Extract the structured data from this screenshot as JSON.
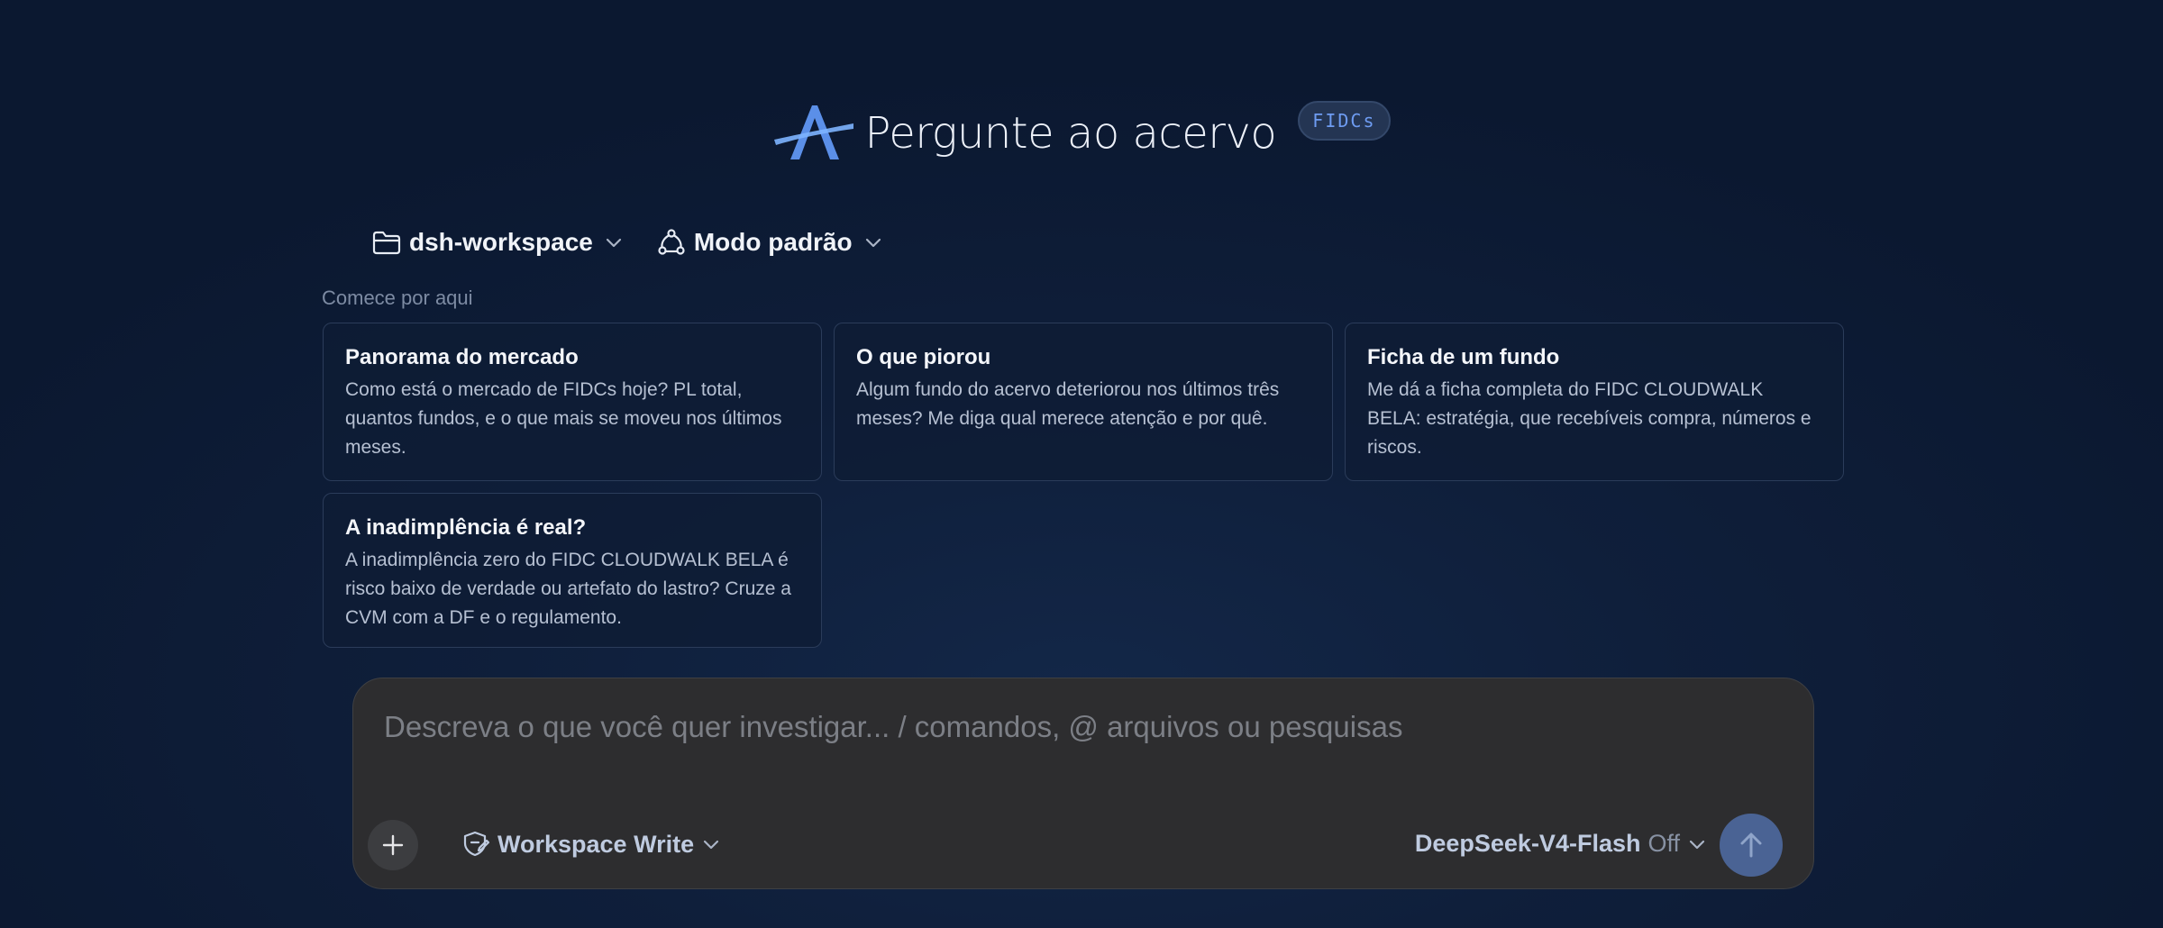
{
  "header": {
    "title": "Pergunte ao acervo",
    "badge": "FIDCs",
    "logo_icon": "acervo-logo-icon"
  },
  "selectors": {
    "workspace": {
      "label": "dsh-workspace",
      "icon": "folder-icon"
    },
    "mode": {
      "label": "Modo padrão",
      "icon": "nodes-icon"
    }
  },
  "suggestions": {
    "heading": "Comece por aqui",
    "cards": [
      {
        "title": "Panorama do mercado",
        "description": "Como está o mercado de FIDCs hoje? PL total, quantos fundos, e o que mais se moveu nos últimos meses."
      },
      {
        "title": "O que piorou",
        "description": "Algum fundo do acervo deteriorou nos últimos três meses? Me diga qual merece atenção e por quê."
      },
      {
        "title": "Ficha de um fundo",
        "description": "Me dá a ficha completa do FIDC CLOUDWALK BELA: estratégia, que recebíveis compra, números e riscos."
      },
      {
        "title": "A inadimplência é real?",
        "description": "A inadimplência zero do FIDC CLOUDWALK BELA é risco baixo de verdade ou artefato do lastro? Cruze a CVM com a DF e o regulamento."
      }
    ]
  },
  "composer": {
    "placeholder": "Descreva o que você quer investigar... / comandos, @ arquivos ou pesquisas",
    "value": "",
    "permission_mode": "Workspace Write",
    "model": "DeepSeek-V4-Flash",
    "model_state": "Off"
  },
  "colors": {
    "background": "#0f1f3b",
    "accent": "#4a6394",
    "badge_text": "#6e9cf2",
    "composer_bg": "#2d2d2f"
  }
}
